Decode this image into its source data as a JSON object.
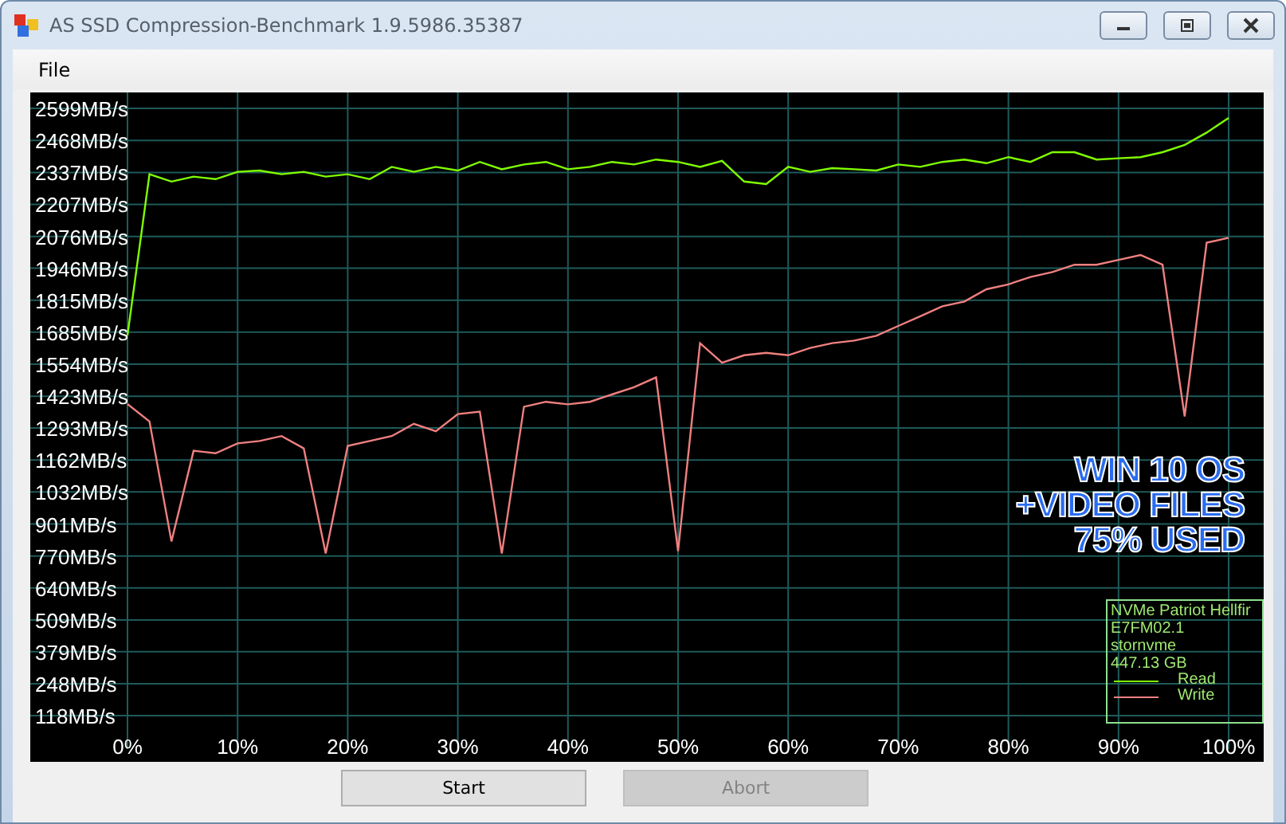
{
  "window": {
    "title": "AS SSD Compression-Benchmark 1.9.5986.35387"
  },
  "menu": [
    {
      "label": "File"
    }
  ],
  "chart": {
    "chart_data": {
      "type": "line",
      "x": [
        0,
        2,
        4,
        6,
        8,
        10,
        12,
        14,
        16,
        18,
        20,
        22,
        24,
        26,
        28,
        30,
        32,
        34,
        36,
        38,
        40,
        42,
        44,
        46,
        48,
        50,
        52,
        54,
        56,
        58,
        60,
        62,
        64,
        66,
        68,
        70,
        72,
        74,
        76,
        78,
        80,
        82,
        84,
        86,
        88,
        90,
        92,
        94,
        96,
        98,
        100
      ],
      "series": [
        {
          "name": "Read",
          "color": "#80ff00",
          "values": [
            1672,
            2330,
            2300,
            2320,
            2310,
            2340,
            2345,
            2330,
            2340,
            2320,
            2330,
            2310,
            2360,
            2340,
            2360,
            2345,
            2380,
            2350,
            2370,
            2380,
            2350,
            2360,
            2380,
            2370,
            2390,
            2380,
            2360,
            2385,
            2300,
            2290,
            2360,
            2340,
            2355,
            2350,
            2345,
            2370,
            2360,
            2380,
            2390,
            2375,
            2400,
            2380,
            2420,
            2420,
            2390,
            2395,
            2400,
            2420,
            2450,
            2500,
            2560
          ]
        },
        {
          "name": "Write",
          "color": "#f08080",
          "values": [
            1391,
            1320,
            830,
            1200,
            1190,
            1230,
            1240,
            1260,
            1210,
            780,
            1220,
            1240,
            1260,
            1310,
            1280,
            1350,
            1360,
            780,
            1380,
            1400,
            1390,
            1400,
            1430,
            1460,
            1500,
            790,
            1640,
            1560,
            1590,
            1600,
            1590,
            1620,
            1640,
            1650,
            1670,
            1710,
            1750,
            1790,
            1810,
            1860,
            1880,
            1910,
            1930,
            1960,
            1960,
            1980,
            2000,
            1960,
            1340,
            2050,
            2070
          ]
        }
      ],
      "xlim": [
        0,
        100
      ],
      "ylim": [
        118,
        2599
      ],
      "grid": true,
      "xticks": [
        {
          "value": 0,
          "label": "0%"
        },
        {
          "value": 10,
          "label": "10%"
        },
        {
          "value": 20,
          "label": "20%"
        },
        {
          "value": 30,
          "label": "30%"
        },
        {
          "value": 40,
          "label": "40%"
        },
        {
          "value": 50,
          "label": "50%"
        },
        {
          "value": 60,
          "label": "60%"
        },
        {
          "value": 70,
          "label": "70%"
        },
        {
          "value": 80,
          "label": "80%"
        },
        {
          "value": 90,
          "label": "90%"
        },
        {
          "value": 100,
          "label": "100%"
        }
      ],
      "yticks": [
        {
          "value": 2599,
          "label": "2599MB/s"
        },
        {
          "value": 2468,
          "label": "2468MB/s"
        },
        {
          "value": 2337,
          "label": "2337MB/s"
        },
        {
          "value": 2207,
          "label": "2207MB/s"
        },
        {
          "value": 2076,
          "label": "2076MB/s"
        },
        {
          "value": 1946,
          "label": "1946MB/s"
        },
        {
          "value": 1815,
          "label": "1815MB/s"
        },
        {
          "value": 1685,
          "label": "1685MB/s"
        },
        {
          "value": 1554,
          "label": "1554MB/s"
        },
        {
          "value": 1423,
          "label": "1423MB/s"
        },
        {
          "value": 1293,
          "label": "1293MB/s"
        },
        {
          "value": 1162,
          "label": "1162MB/s"
        },
        {
          "value": 1032,
          "label": "1032MB/s"
        },
        {
          "value": 901,
          "label": "901MB/s"
        },
        {
          "value": 770,
          "label": "770MB/s"
        },
        {
          "value": 640,
          "label": "640MB/s"
        },
        {
          "value": 509,
          "label": "509MB/s"
        },
        {
          "value": 379,
          "label": "379MB/s"
        },
        {
          "value": 248,
          "label": "248MB/s"
        },
        {
          "value": 118,
          "label": "118MB/s"
        }
      ]
    },
    "annotation": [
      "WIN 10 OS",
      "+VIDEO FILES",
      "75% USED"
    ],
    "device_info": [
      "NVMe Patriot Hellfir",
      "E7FM02.1",
      "stornvme",
      "447.13 GB"
    ]
  },
  "buttons": [
    {
      "label": "Start",
      "disabled": false
    },
    {
      "label": "Abort",
      "disabled": true
    }
  ]
}
